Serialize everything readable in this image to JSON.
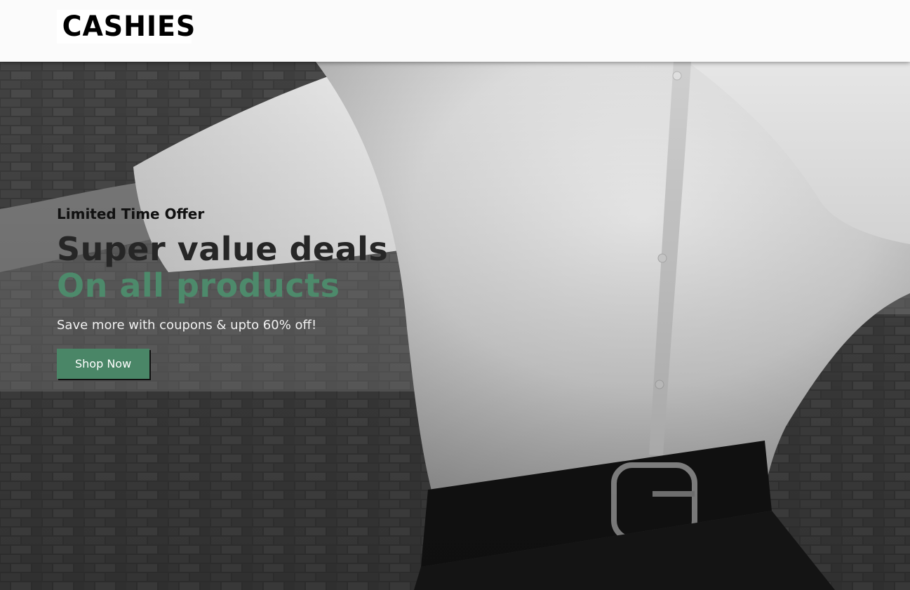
{
  "header": {
    "logo_text": "CASHIES"
  },
  "hero": {
    "eyebrow": "Limited Time Offer",
    "headline_line1": "Super value deals",
    "headline_line2": "On all products",
    "subtext": "Save more with coupons & upto 60% off!",
    "cta_label": "Shop Now"
  },
  "colors": {
    "accent_green": "#4a8667",
    "headline_dark": "#262626",
    "header_bg": "#fbfbfb"
  }
}
